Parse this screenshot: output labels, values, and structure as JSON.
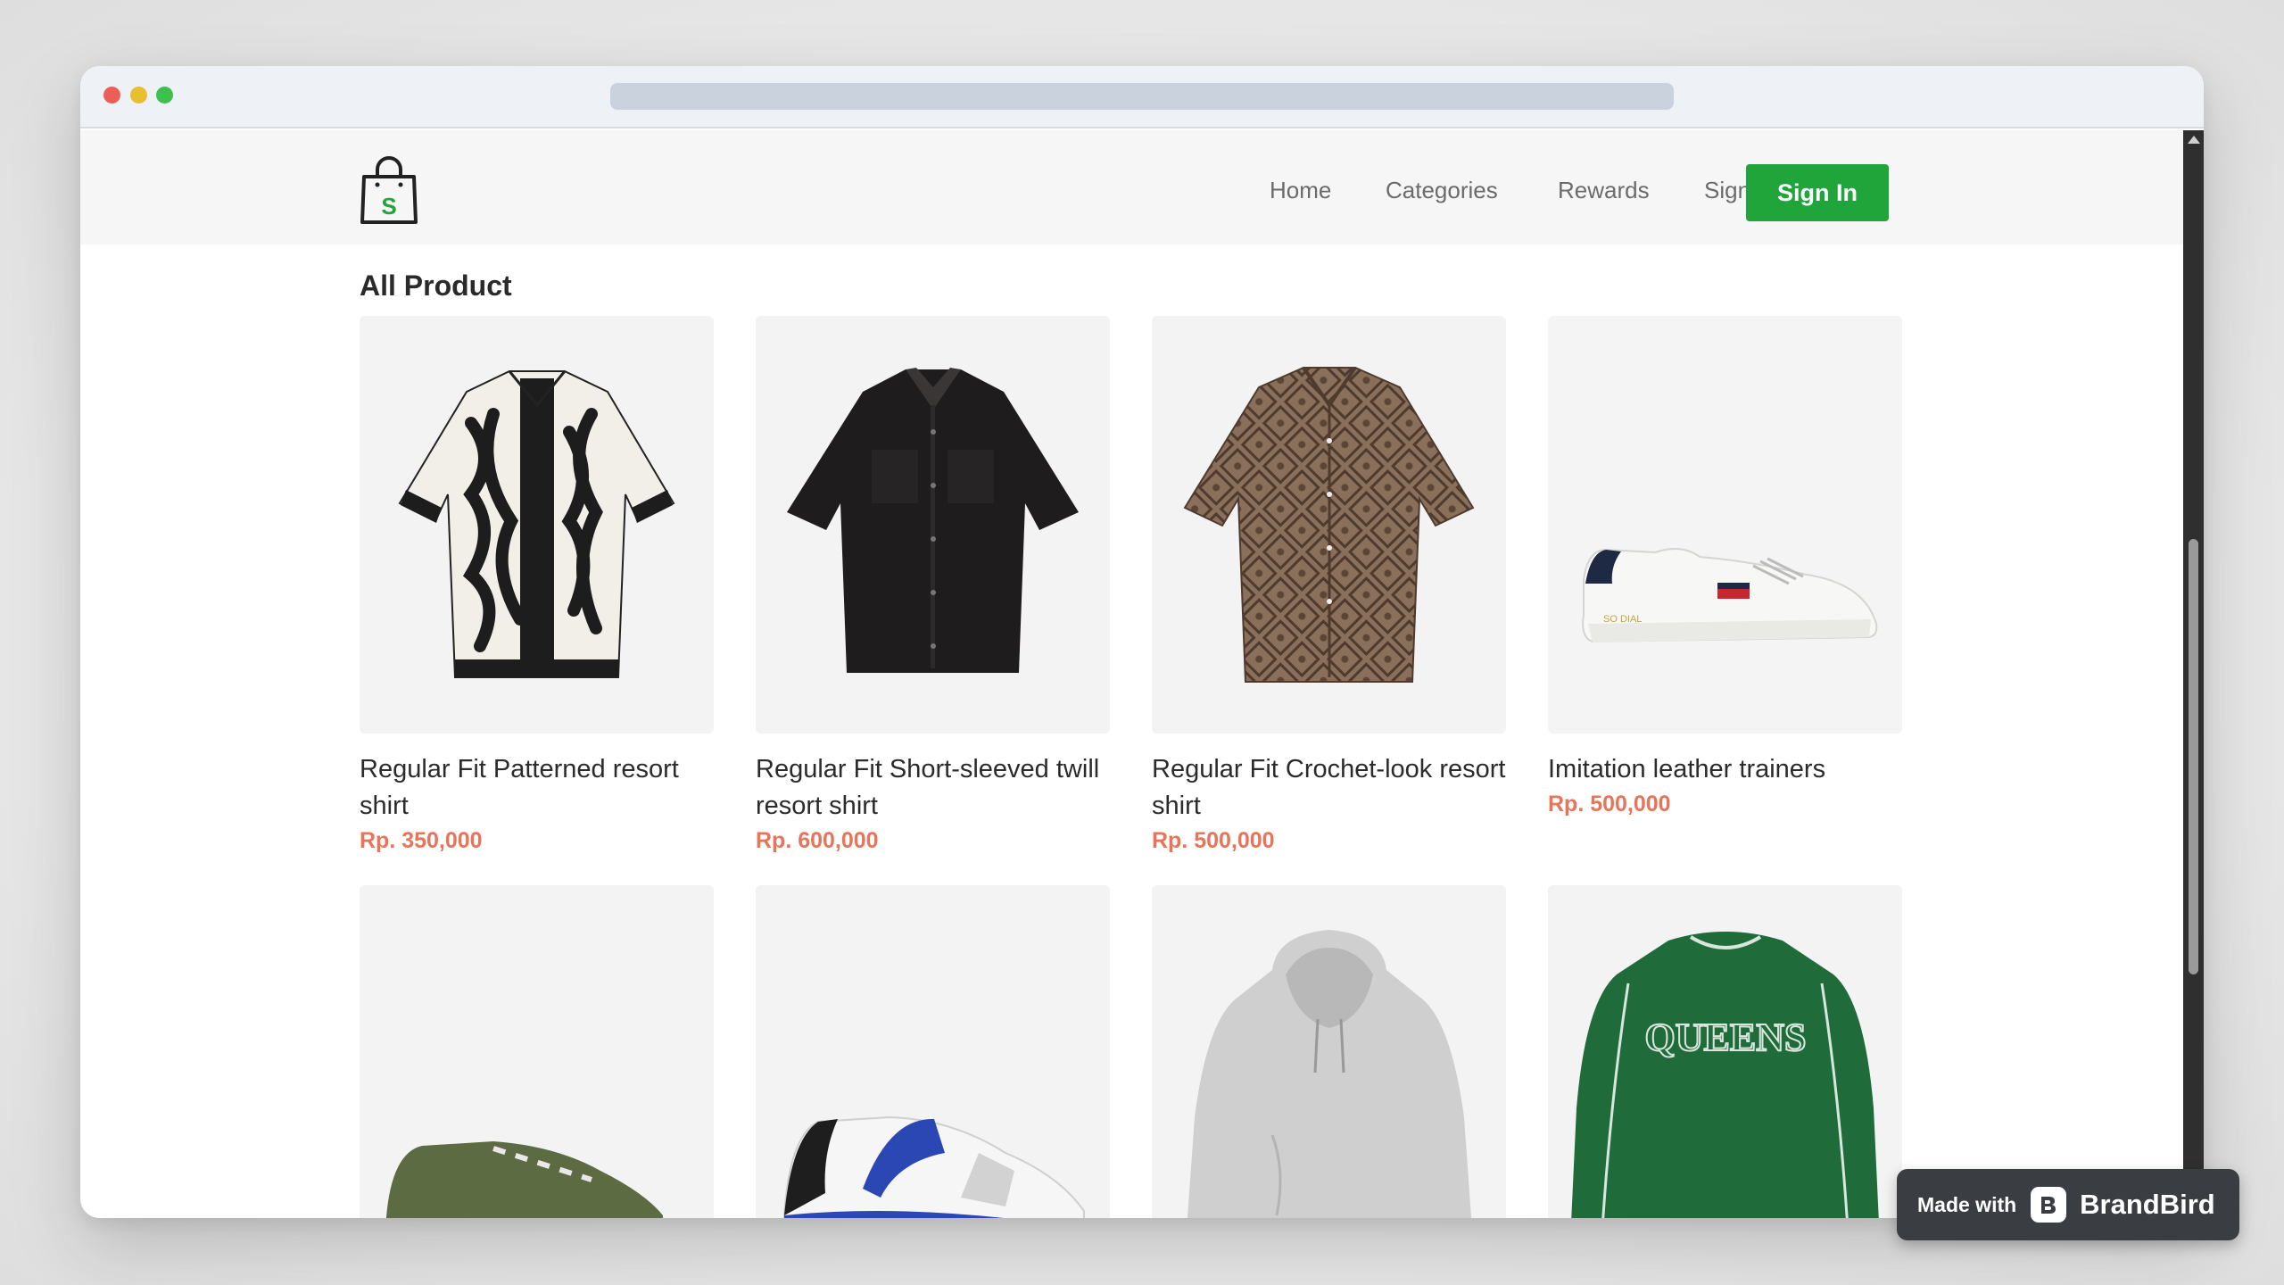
{
  "nav": {
    "logo_letter": "S",
    "links": [
      "Home",
      "Categories",
      "Rewards",
      "Sign Up"
    ],
    "signin_label": "Sign In"
  },
  "section": {
    "title": "All Product"
  },
  "products": [
    {
      "name": "Regular Fit Patterned resort shirt",
      "price": "Rp. 350,000"
    },
    {
      "name": "Regular Fit Short-sleeved twill resort shirt",
      "price": "Rp. 600,000"
    },
    {
      "name": "Regular Fit Crochet-look resort shirt",
      "price": "Rp. 500,000"
    },
    {
      "name": "Imitation leather trainers",
      "price": "Rp. 500,000"
    }
  ],
  "badge": {
    "made_with": "Made with",
    "brand": "BrandBird"
  },
  "colors": {
    "accent": "#1fa53a",
    "price": "#e8745a",
    "text": "#2b2b2b"
  },
  "icons": [
    "shopping-bag-logo-icon",
    "brandbird-icon"
  ]
}
